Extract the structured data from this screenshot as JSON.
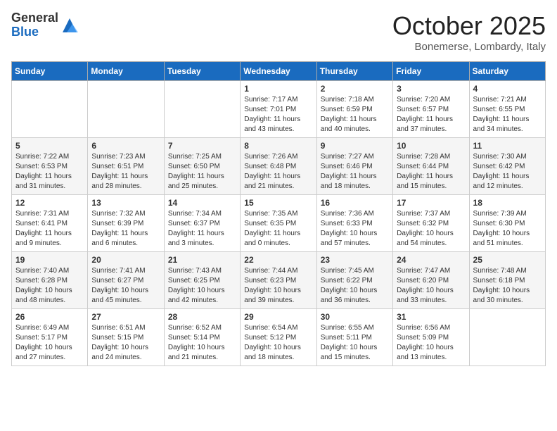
{
  "header": {
    "logo_general": "General",
    "logo_blue": "Blue",
    "month_title": "October 2025",
    "location": "Bonemerse, Lombardy, Italy"
  },
  "days_of_week": [
    "Sunday",
    "Monday",
    "Tuesday",
    "Wednesday",
    "Thursday",
    "Friday",
    "Saturday"
  ],
  "weeks": [
    [
      {
        "day": "",
        "sunrise": "",
        "sunset": "",
        "daylight": ""
      },
      {
        "day": "",
        "sunrise": "",
        "sunset": "",
        "daylight": ""
      },
      {
        "day": "",
        "sunrise": "",
        "sunset": "",
        "daylight": ""
      },
      {
        "day": "1",
        "sunrise": "Sunrise: 7:17 AM",
        "sunset": "Sunset: 7:01 PM",
        "daylight": "Daylight: 11 hours and 43 minutes."
      },
      {
        "day": "2",
        "sunrise": "Sunrise: 7:18 AM",
        "sunset": "Sunset: 6:59 PM",
        "daylight": "Daylight: 11 hours and 40 minutes."
      },
      {
        "day": "3",
        "sunrise": "Sunrise: 7:20 AM",
        "sunset": "Sunset: 6:57 PM",
        "daylight": "Daylight: 11 hours and 37 minutes."
      },
      {
        "day": "4",
        "sunrise": "Sunrise: 7:21 AM",
        "sunset": "Sunset: 6:55 PM",
        "daylight": "Daylight: 11 hours and 34 minutes."
      }
    ],
    [
      {
        "day": "5",
        "sunrise": "Sunrise: 7:22 AM",
        "sunset": "Sunset: 6:53 PM",
        "daylight": "Daylight: 11 hours and 31 minutes."
      },
      {
        "day": "6",
        "sunrise": "Sunrise: 7:23 AM",
        "sunset": "Sunset: 6:51 PM",
        "daylight": "Daylight: 11 hours and 28 minutes."
      },
      {
        "day": "7",
        "sunrise": "Sunrise: 7:25 AM",
        "sunset": "Sunset: 6:50 PM",
        "daylight": "Daylight: 11 hours and 25 minutes."
      },
      {
        "day": "8",
        "sunrise": "Sunrise: 7:26 AM",
        "sunset": "Sunset: 6:48 PM",
        "daylight": "Daylight: 11 hours and 21 minutes."
      },
      {
        "day": "9",
        "sunrise": "Sunrise: 7:27 AM",
        "sunset": "Sunset: 6:46 PM",
        "daylight": "Daylight: 11 hours and 18 minutes."
      },
      {
        "day": "10",
        "sunrise": "Sunrise: 7:28 AM",
        "sunset": "Sunset: 6:44 PM",
        "daylight": "Daylight: 11 hours and 15 minutes."
      },
      {
        "day": "11",
        "sunrise": "Sunrise: 7:30 AM",
        "sunset": "Sunset: 6:42 PM",
        "daylight": "Daylight: 11 hours and 12 minutes."
      }
    ],
    [
      {
        "day": "12",
        "sunrise": "Sunrise: 7:31 AM",
        "sunset": "Sunset: 6:41 PM",
        "daylight": "Daylight: 11 hours and 9 minutes."
      },
      {
        "day": "13",
        "sunrise": "Sunrise: 7:32 AM",
        "sunset": "Sunset: 6:39 PM",
        "daylight": "Daylight: 11 hours and 6 minutes."
      },
      {
        "day": "14",
        "sunrise": "Sunrise: 7:34 AM",
        "sunset": "Sunset: 6:37 PM",
        "daylight": "Daylight: 11 hours and 3 minutes."
      },
      {
        "day": "15",
        "sunrise": "Sunrise: 7:35 AM",
        "sunset": "Sunset: 6:35 PM",
        "daylight": "Daylight: 11 hours and 0 minutes."
      },
      {
        "day": "16",
        "sunrise": "Sunrise: 7:36 AM",
        "sunset": "Sunset: 6:33 PM",
        "daylight": "Daylight: 10 hours and 57 minutes."
      },
      {
        "day": "17",
        "sunrise": "Sunrise: 7:37 AM",
        "sunset": "Sunset: 6:32 PM",
        "daylight": "Daylight: 10 hours and 54 minutes."
      },
      {
        "day": "18",
        "sunrise": "Sunrise: 7:39 AM",
        "sunset": "Sunset: 6:30 PM",
        "daylight": "Daylight: 10 hours and 51 minutes."
      }
    ],
    [
      {
        "day": "19",
        "sunrise": "Sunrise: 7:40 AM",
        "sunset": "Sunset: 6:28 PM",
        "daylight": "Daylight: 10 hours and 48 minutes."
      },
      {
        "day": "20",
        "sunrise": "Sunrise: 7:41 AM",
        "sunset": "Sunset: 6:27 PM",
        "daylight": "Daylight: 10 hours and 45 minutes."
      },
      {
        "day": "21",
        "sunrise": "Sunrise: 7:43 AM",
        "sunset": "Sunset: 6:25 PM",
        "daylight": "Daylight: 10 hours and 42 minutes."
      },
      {
        "day": "22",
        "sunrise": "Sunrise: 7:44 AM",
        "sunset": "Sunset: 6:23 PM",
        "daylight": "Daylight: 10 hours and 39 minutes."
      },
      {
        "day": "23",
        "sunrise": "Sunrise: 7:45 AM",
        "sunset": "Sunset: 6:22 PM",
        "daylight": "Daylight: 10 hours and 36 minutes."
      },
      {
        "day": "24",
        "sunrise": "Sunrise: 7:47 AM",
        "sunset": "Sunset: 6:20 PM",
        "daylight": "Daylight: 10 hours and 33 minutes."
      },
      {
        "day": "25",
        "sunrise": "Sunrise: 7:48 AM",
        "sunset": "Sunset: 6:18 PM",
        "daylight": "Daylight: 10 hours and 30 minutes."
      }
    ],
    [
      {
        "day": "26",
        "sunrise": "Sunrise: 6:49 AM",
        "sunset": "Sunset: 5:17 PM",
        "daylight": "Daylight: 10 hours and 27 minutes."
      },
      {
        "day": "27",
        "sunrise": "Sunrise: 6:51 AM",
        "sunset": "Sunset: 5:15 PM",
        "daylight": "Daylight: 10 hours and 24 minutes."
      },
      {
        "day": "28",
        "sunrise": "Sunrise: 6:52 AM",
        "sunset": "Sunset: 5:14 PM",
        "daylight": "Daylight: 10 hours and 21 minutes."
      },
      {
        "day": "29",
        "sunrise": "Sunrise: 6:54 AM",
        "sunset": "Sunset: 5:12 PM",
        "daylight": "Daylight: 10 hours and 18 minutes."
      },
      {
        "day": "30",
        "sunrise": "Sunrise: 6:55 AM",
        "sunset": "Sunset: 5:11 PM",
        "daylight": "Daylight: 10 hours and 15 minutes."
      },
      {
        "day": "31",
        "sunrise": "Sunrise: 6:56 AM",
        "sunset": "Sunset: 5:09 PM",
        "daylight": "Daylight: 10 hours and 13 minutes."
      },
      {
        "day": "",
        "sunrise": "",
        "sunset": "",
        "daylight": ""
      }
    ]
  ]
}
